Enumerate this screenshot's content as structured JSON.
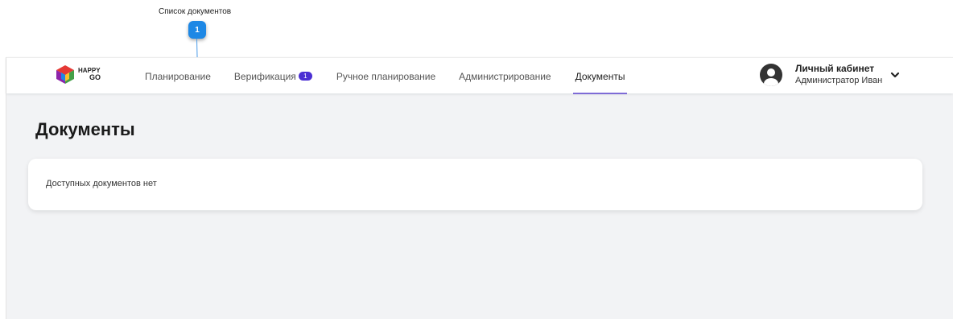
{
  "annotation": {
    "label": "Список документов",
    "badge": "1"
  },
  "brand": {
    "name_top": "HAPPY",
    "name_bottom": "GO",
    "colors": [
      "#e53935",
      "#fbc02d",
      "#43a047",
      "#1e88e5",
      "#8e24aa"
    ]
  },
  "nav": {
    "items": [
      {
        "label": "Планирование"
      },
      {
        "label": "Верификация",
        "badge": "1"
      },
      {
        "label": "Ручное планирование"
      },
      {
        "label": "Администрирование"
      },
      {
        "label": "Документы",
        "active": true
      }
    ],
    "accent": "#7e6bd6",
    "badge_color": "#4b2fd3"
  },
  "account": {
    "title": "Личный кабинет",
    "subtitle": "Администратор Иван",
    "icon": "user-avatar-icon",
    "menu_icon": "chevron-down-icon"
  },
  "page": {
    "title": "Документы",
    "empty_message": "Доступных документов нет"
  }
}
